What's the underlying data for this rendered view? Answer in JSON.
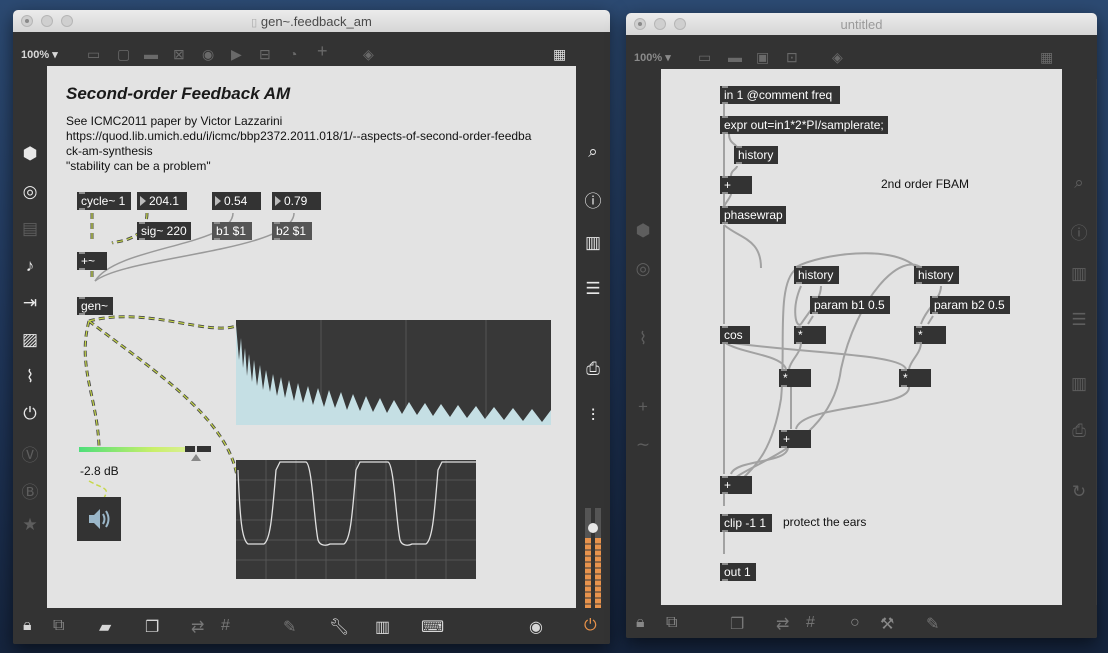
{
  "left_window": {
    "title": "gen~.feedback_am",
    "zoom": "100%",
    "patch": {
      "heading": "Second-order Feedback AM",
      "description": [
        "See ICMC2011 paper by Victor Lazzarini",
        "https://quod.lib.umich.edu/i/icmc/bbp2372.2011.018/1/--aspects-of-second-order-feedba",
        "ck-am-synthesis",
        "\"stability can be a problem\""
      ],
      "objects": {
        "cycle": "cycle~ 1",
        "num_freq": "204.1",
        "num_b1": "0.54",
        "num_b2": "0.79",
        "sig": "sig~ 220",
        "msg_b1": "b1 $1",
        "msg_b2": "b2 $1",
        "plus": "+~",
        "gen": "gen~"
      },
      "gain": {
        "readout": "-2.8 dB",
        "level": 0.8
      }
    },
    "sidebar_icons": [
      "package-icon",
      "target-icon",
      "clip-icon",
      "music-note-icon",
      "playlist-icon",
      "image-icon",
      "paperclip-icon",
      "plugin-icon",
      "vst-icon",
      "beap-icon",
      "star-icon"
    ],
    "right_icons": [
      "search-icon",
      "info-icon",
      "book-icon",
      "list-icon",
      "camera-icon",
      "mixer-icon"
    ]
  },
  "right_window": {
    "title": "untitled",
    "zoom": "100%",
    "patch": {
      "objects": {
        "in1": "in 1 @comment freq",
        "expr": "expr out=in1*2*PI/samplerate;",
        "history0": "history",
        "plus0": "+",
        "phasewrap": "phasewrap",
        "history1": "history",
        "history2": "history",
        "param1": "param b1 0.5",
        "param2": "param b2 0.5",
        "cos": "cos",
        "mul_a": "*",
        "mul_b": "*",
        "mul_c": "*",
        "mul_d": "*",
        "plus1": "+",
        "plus2": "+",
        "clip": "clip -1 1",
        "out": "out 1"
      },
      "comment_title": "2nd order FBAM",
      "comment_clip": "protect the ears"
    }
  },
  "colors": {
    "canvas": "#e3e3e3",
    "object": "#333333",
    "signal_cable": "#b5c73a",
    "spectrum_fill": "#c5dfe4",
    "meter_orange": "#e8934c",
    "power_orange": "#e8924a"
  }
}
